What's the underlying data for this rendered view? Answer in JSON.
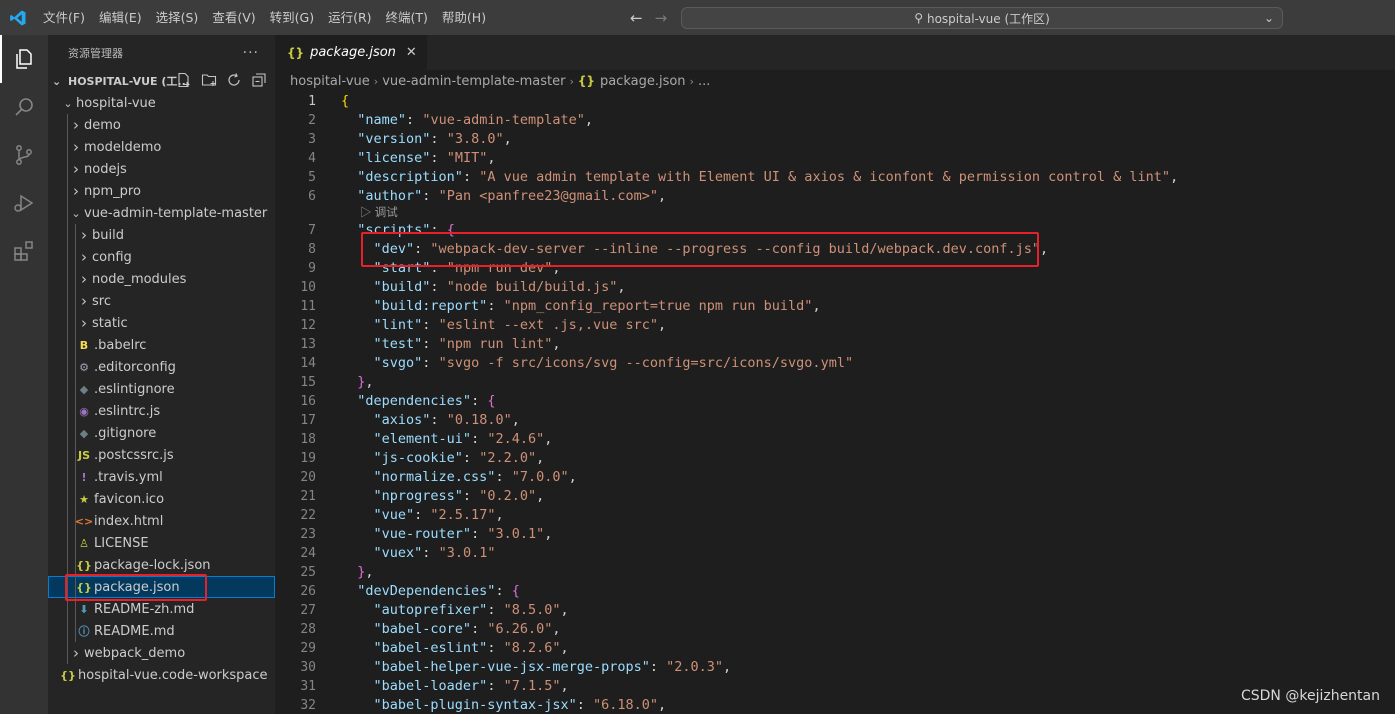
{
  "menubar": {
    "items": [
      "文件(F)",
      "编辑(E)",
      "选择(S)",
      "查看(V)",
      "转到(G)",
      "运行(R)",
      "终端(T)",
      "帮助(H)"
    ]
  },
  "command_center": {
    "text": "hospital-vue (工作区)"
  },
  "sidebar": {
    "title": "资源管理器",
    "more": "···",
    "workspace_title": "HOSPITAL-VUE (工...",
    "tree": [
      {
        "label": "hospital-vue",
        "depth": 1,
        "kind": "folder-open"
      },
      {
        "label": "demo",
        "depth": 2,
        "kind": "folder"
      },
      {
        "label": "modeldemo",
        "depth": 2,
        "kind": "folder"
      },
      {
        "label": "nodejs",
        "depth": 2,
        "kind": "folder"
      },
      {
        "label": "npm_pro",
        "depth": 2,
        "kind": "folder"
      },
      {
        "label": "vue-admin-template-master",
        "depth": 2,
        "kind": "folder-open"
      },
      {
        "label": "build",
        "depth": 3,
        "kind": "folder"
      },
      {
        "label": "config",
        "depth": 3,
        "kind": "folder"
      },
      {
        "label": "node_modules",
        "depth": 3,
        "kind": "folder"
      },
      {
        "label": "src",
        "depth": 3,
        "kind": "folder"
      },
      {
        "label": "static",
        "depth": 3,
        "kind": "folder"
      },
      {
        "label": ".babelrc",
        "depth": 3,
        "kind": "file",
        "icon": "babel-icon",
        "glyph": "B",
        "color": "#f5da55"
      },
      {
        "label": ".editorconfig",
        "depth": 3,
        "kind": "file",
        "icon": "gear-icon",
        "glyph": "⚙",
        "color": "#9da5b4"
      },
      {
        "label": ".eslintignore",
        "depth": 3,
        "kind": "file",
        "icon": "eslint-icon",
        "glyph": "◆",
        "color": "#6d8086"
      },
      {
        "label": ".eslintrc.js",
        "depth": 3,
        "kind": "file",
        "icon": "eslint-circle-icon",
        "glyph": "◉",
        "color": "#a074c4"
      },
      {
        "label": ".gitignore",
        "depth": 3,
        "kind": "file",
        "icon": "git-icon",
        "glyph": "◆",
        "color": "#6d8086"
      },
      {
        "label": ".postcssrc.js",
        "depth": 3,
        "kind": "file",
        "icon": "js-icon",
        "glyph": "JS",
        "color": "#cbcb41"
      },
      {
        "label": ".travis.yml",
        "depth": 3,
        "kind": "file",
        "icon": "yaml-icon",
        "glyph": "!",
        "color": "#a074c4"
      },
      {
        "label": "favicon.ico",
        "depth": 3,
        "kind": "file",
        "icon": "star-icon",
        "glyph": "★",
        "color": "#cbcb41"
      },
      {
        "label": "index.html",
        "depth": 3,
        "kind": "file",
        "icon": "html-icon",
        "glyph": "<>",
        "color": "#e37933"
      },
      {
        "label": "LICENSE",
        "depth": 3,
        "kind": "file",
        "icon": "license-icon",
        "glyph": "♙",
        "color": "#cbcb41"
      },
      {
        "label": "package-lock.json",
        "depth": 3,
        "kind": "file",
        "icon": "json-icon",
        "glyph": "{}",
        "color": "#cbcb41"
      },
      {
        "label": "package.json",
        "depth": 3,
        "kind": "file",
        "icon": "json-icon",
        "glyph": "{}",
        "color": "#cbcb41",
        "selected": true
      },
      {
        "label": "README-zh.md",
        "depth": 3,
        "kind": "file",
        "icon": "markdown-icon",
        "glyph": "⬇",
        "color": "#519aba"
      },
      {
        "label": "README.md",
        "depth": 3,
        "kind": "file",
        "icon": "info-icon",
        "glyph": "ⓘ",
        "color": "#519aba"
      },
      {
        "label": "webpack_demo",
        "depth": 2,
        "kind": "folder"
      },
      {
        "label": "hospital-vue.code-workspace",
        "depth": 1,
        "kind": "file",
        "icon": "json-icon",
        "glyph": "{}",
        "color": "#cbcb41"
      }
    ]
  },
  "editor": {
    "tab": {
      "label": "package.json",
      "icon": "{}",
      "close": "✕"
    },
    "breadcrumb": [
      "hospital-vue",
      "vue-admin-template-master",
      "package.json",
      "..."
    ],
    "breadcrumb_icon": "{}",
    "codelens": "调试",
    "current_line": 1,
    "lines": [
      [
        [
          "b1",
          "{"
        ]
      ],
      [
        [
          "p",
          "  "
        ],
        [
          "k",
          "\"name\""
        ],
        [
          "p",
          ": "
        ],
        [
          "s",
          "\"vue-admin-template\""
        ],
        [
          "p",
          ","
        ]
      ],
      [
        [
          "p",
          "  "
        ],
        [
          "k",
          "\"version\""
        ],
        [
          "p",
          ": "
        ],
        [
          "s",
          "\"3.8.0\""
        ],
        [
          "p",
          ","
        ]
      ],
      [
        [
          "p",
          "  "
        ],
        [
          "k",
          "\"license\""
        ],
        [
          "p",
          ": "
        ],
        [
          "s",
          "\"MIT\""
        ],
        [
          "p",
          ","
        ]
      ],
      [
        [
          "p",
          "  "
        ],
        [
          "k",
          "\"description\""
        ],
        [
          "p",
          ": "
        ],
        [
          "s",
          "\"A vue admin template with Element UI & axios & iconfont & permission control & lint\""
        ],
        [
          "p",
          ","
        ]
      ],
      [
        [
          "p",
          "  "
        ],
        [
          "k",
          "\"author\""
        ],
        [
          "p",
          ": "
        ],
        [
          "s",
          "\"Pan <panfree23@gmail.com>\""
        ],
        [
          "p",
          ","
        ]
      ],
      [
        [
          "p",
          "  "
        ],
        [
          "k",
          "\"scripts\""
        ],
        [
          "p",
          ": "
        ],
        [
          "b2",
          "{"
        ]
      ],
      [
        [
          "p",
          "    "
        ],
        [
          "k",
          "\"dev\""
        ],
        [
          "p",
          ": "
        ],
        [
          "s",
          "\"webpack-dev-server --inline --progress --config build/webpack.dev.conf.js\""
        ],
        [
          "p",
          ","
        ]
      ],
      [
        [
          "p",
          "    "
        ],
        [
          "k",
          "\"start\""
        ],
        [
          "p",
          ": "
        ],
        [
          "s",
          "\"npm run dev\""
        ],
        [
          "p",
          ","
        ]
      ],
      [
        [
          "p",
          "    "
        ],
        [
          "k",
          "\"build\""
        ],
        [
          "p",
          ": "
        ],
        [
          "s",
          "\"node build/build.js\""
        ],
        [
          "p",
          ","
        ]
      ],
      [
        [
          "p",
          "    "
        ],
        [
          "k",
          "\"build:report\""
        ],
        [
          "p",
          ": "
        ],
        [
          "s",
          "\"npm_config_report=true npm run build\""
        ],
        [
          "p",
          ","
        ]
      ],
      [
        [
          "p",
          "    "
        ],
        [
          "k",
          "\"lint\""
        ],
        [
          "p",
          ": "
        ],
        [
          "s",
          "\"eslint --ext .js,.vue src\""
        ],
        [
          "p",
          ","
        ]
      ],
      [
        [
          "p",
          "    "
        ],
        [
          "k",
          "\"test\""
        ],
        [
          "p",
          ": "
        ],
        [
          "s",
          "\"npm run lint\""
        ],
        [
          "p",
          ","
        ]
      ],
      [
        [
          "p",
          "    "
        ],
        [
          "k",
          "\"svgo\""
        ],
        [
          "p",
          ": "
        ],
        [
          "s",
          "\"svgo -f src/icons/svg --config=src/icons/svgo.yml\""
        ]
      ],
      [
        [
          "p",
          "  "
        ],
        [
          "b2",
          "}"
        ],
        [
          "p",
          ","
        ]
      ],
      [
        [
          "p",
          "  "
        ],
        [
          "k",
          "\"dependencies\""
        ],
        [
          "p",
          ": "
        ],
        [
          "b2",
          "{"
        ]
      ],
      [
        [
          "p",
          "    "
        ],
        [
          "k",
          "\"axios\""
        ],
        [
          "p",
          ": "
        ],
        [
          "s",
          "\"0.18.0\""
        ],
        [
          "p",
          ","
        ]
      ],
      [
        [
          "p",
          "    "
        ],
        [
          "k",
          "\"element-ui\""
        ],
        [
          "p",
          ": "
        ],
        [
          "s",
          "\"2.4.6\""
        ],
        [
          "p",
          ","
        ]
      ],
      [
        [
          "p",
          "    "
        ],
        [
          "k",
          "\"js-cookie\""
        ],
        [
          "p",
          ": "
        ],
        [
          "s",
          "\"2.2.0\""
        ],
        [
          "p",
          ","
        ]
      ],
      [
        [
          "p",
          "    "
        ],
        [
          "k",
          "\"normalize.css\""
        ],
        [
          "p",
          ": "
        ],
        [
          "s",
          "\"7.0.0\""
        ],
        [
          "p",
          ","
        ]
      ],
      [
        [
          "p",
          "    "
        ],
        [
          "k",
          "\"nprogress\""
        ],
        [
          "p",
          ": "
        ],
        [
          "s",
          "\"0.2.0\""
        ],
        [
          "p",
          ","
        ]
      ],
      [
        [
          "p",
          "    "
        ],
        [
          "k",
          "\"vue\""
        ],
        [
          "p",
          ": "
        ],
        [
          "s",
          "\"2.5.17\""
        ],
        [
          "p",
          ","
        ]
      ],
      [
        [
          "p",
          "    "
        ],
        [
          "k",
          "\"vue-router\""
        ],
        [
          "p",
          ": "
        ],
        [
          "s",
          "\"3.0.1\""
        ],
        [
          "p",
          ","
        ]
      ],
      [
        [
          "p",
          "    "
        ],
        [
          "k",
          "\"vuex\""
        ],
        [
          "p",
          ": "
        ],
        [
          "s",
          "\"3.0.1\""
        ]
      ],
      [
        [
          "p",
          "  "
        ],
        [
          "b2",
          "}"
        ],
        [
          "p",
          ","
        ]
      ],
      [
        [
          "p",
          "  "
        ],
        [
          "k",
          "\"devDependencies\""
        ],
        [
          "p",
          ": "
        ],
        [
          "b2",
          "{"
        ]
      ],
      [
        [
          "p",
          "    "
        ],
        [
          "k",
          "\"autoprefixer\""
        ],
        [
          "p",
          ": "
        ],
        [
          "s",
          "\"8.5.0\""
        ],
        [
          "p",
          ","
        ]
      ],
      [
        [
          "p",
          "    "
        ],
        [
          "k",
          "\"babel-core\""
        ],
        [
          "p",
          ": "
        ],
        [
          "s",
          "\"6.26.0\""
        ],
        [
          "p",
          ","
        ]
      ],
      [
        [
          "p",
          "    "
        ],
        [
          "k",
          "\"babel-eslint\""
        ],
        [
          "p",
          ": "
        ],
        [
          "s",
          "\"8.2.6\""
        ],
        [
          "p",
          ","
        ]
      ],
      [
        [
          "p",
          "    "
        ],
        [
          "k",
          "\"babel-helper-vue-jsx-merge-props\""
        ],
        [
          "p",
          ": "
        ],
        [
          "s",
          "\"2.0.3\""
        ],
        [
          "p",
          ","
        ]
      ],
      [
        [
          "p",
          "    "
        ],
        [
          "k",
          "\"babel-loader\""
        ],
        [
          "p",
          ": "
        ],
        [
          "s",
          "\"7.1.5\""
        ],
        [
          "p",
          ","
        ]
      ],
      [
        [
          "p",
          "    "
        ],
        [
          "k",
          "\"babel-plugin-syntax-jsx\""
        ],
        [
          "p",
          ": "
        ],
        [
          "s",
          "\"6.18.0\""
        ],
        [
          "p",
          ","
        ]
      ]
    ]
  },
  "watermark": "CSDN @kejizhentan"
}
